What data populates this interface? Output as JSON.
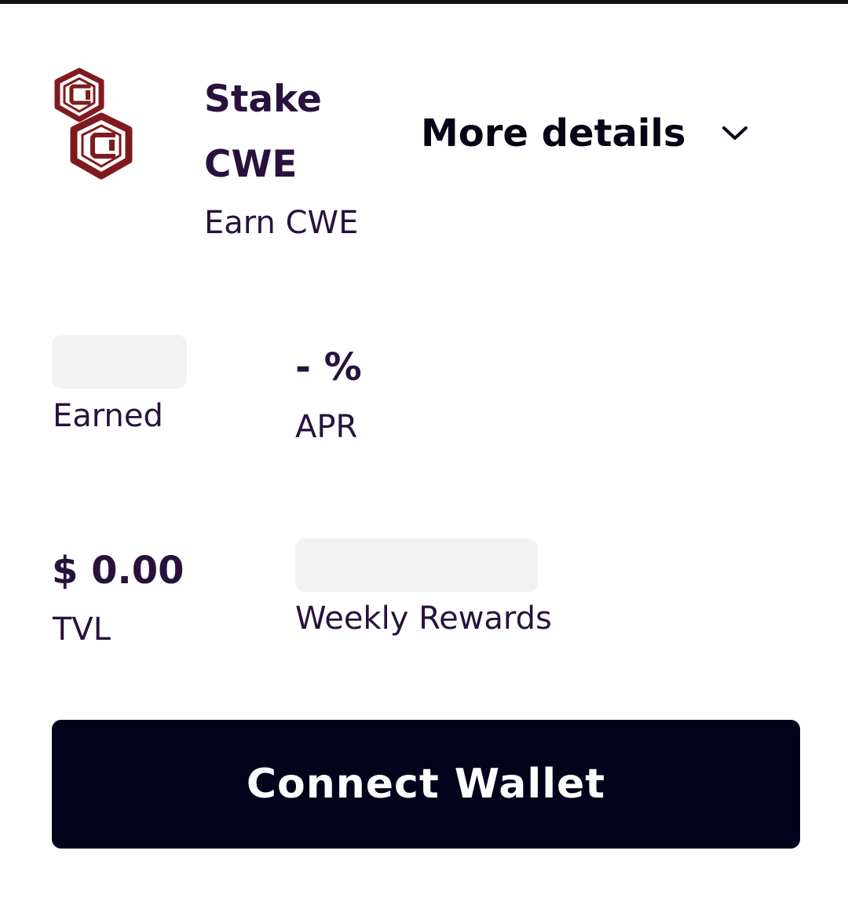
{
  "pool": {
    "logo_icon": "cwe-token-logo-icon",
    "logo_color": "#7f1b1f",
    "title_line_1": "Stake",
    "title_line_2": "CWE",
    "subtitle": "Earn CWE"
  },
  "details_toggle": {
    "label": "More details",
    "icon": "chevron-down-icon"
  },
  "stats": {
    "apr_value": "- %",
    "apr_label": "APR",
    "earned_label": "Earned",
    "tvl_value": "$ 0.00",
    "tvl_label": "TVL",
    "weekly_rewards_label": "Weekly Rewards"
  },
  "actions": {
    "connect_wallet_label": "Connect Wallet"
  },
  "colors": {
    "primary_text": "#28123d",
    "button_background": "#02021a",
    "skeleton": "#f2f2f2"
  }
}
